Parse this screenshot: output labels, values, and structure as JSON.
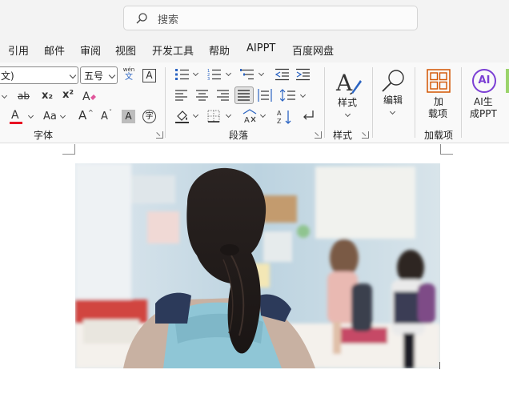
{
  "search": {
    "placeholder": "搜索"
  },
  "menu": {
    "tabs": [
      {
        "label": "引用"
      },
      {
        "label": "邮件"
      },
      {
        "label": "审阅"
      },
      {
        "label": "视图"
      },
      {
        "label": "开发工具"
      },
      {
        "label": "帮助"
      },
      {
        "label": "AIPPT"
      },
      {
        "label": "百度网盘"
      }
    ]
  },
  "ribbon": {
    "font": {
      "group_label": "字体",
      "font_name": "文)",
      "font_size": "五号",
      "pinyin_top": "wén",
      "pinyin_bottom": "文",
      "border_char": "A",
      "strike": "ab",
      "sub": "x₂",
      "sup": "x²",
      "font_color": "A",
      "change_case": "Aa",
      "grow": "A",
      "shrink": "A",
      "shade": "A",
      "enclose": "字"
    },
    "paragraph": {
      "group_label": "段落"
    },
    "styles": {
      "group_label": "样式",
      "button_label": "样式"
    },
    "editing": {
      "button_label": "编辑"
    },
    "addins": {
      "group_label": "加载项",
      "button_line1": "加",
      "button_line2": "载项"
    },
    "aippt": {
      "button_line1": "AI生",
      "button_line2": "成PPT",
      "logo_text": "AI"
    }
  },
  "colors": {
    "font_color_bar": "#e81123",
    "addin_accent": "#d35400",
    "ai_logo": "#7b3fd4"
  }
}
